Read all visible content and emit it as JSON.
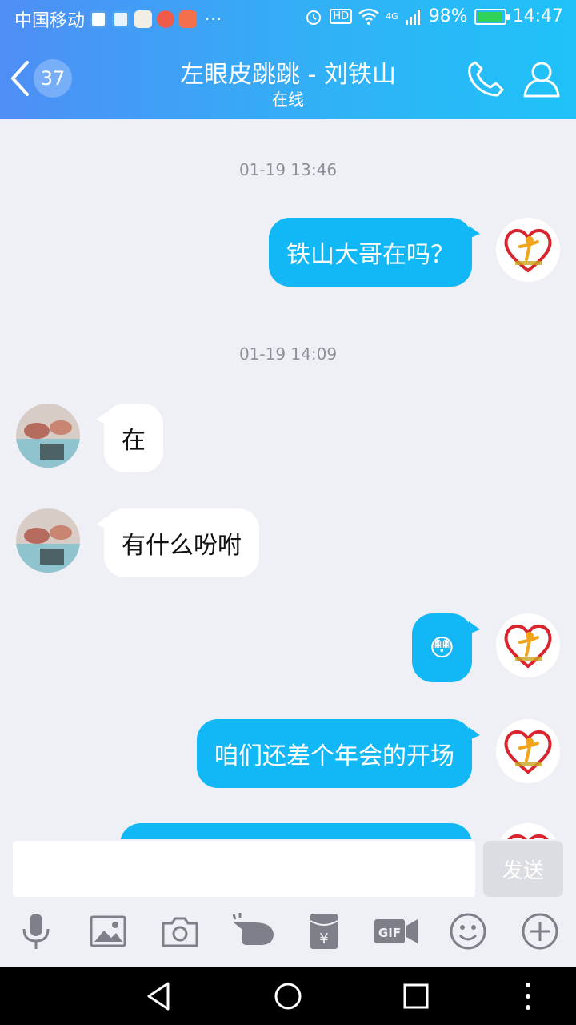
{
  "status_bar": {
    "carrier": "中国移动",
    "dots": "···",
    "hd": "HD",
    "network": "4G",
    "battery": "98%",
    "battery_level": 0.98,
    "time": "14:47"
  },
  "header": {
    "unread_count": "37",
    "title": "左眼皮跳跳 - 刘铁山",
    "subtitle": "在线"
  },
  "messages": [
    {
      "type": "time",
      "text": "01-19 13:46"
    },
    {
      "type": "out",
      "text": "铁山大哥在吗？"
    },
    {
      "type": "time",
      "text": "01-19 14:09"
    },
    {
      "type": "in",
      "text": "在"
    },
    {
      "type": "in",
      "text": "有什么吩咐"
    },
    {
      "type": "out",
      "text": "😳"
    },
    {
      "type": "out",
      "text": "咱们还差个年会的开场"
    }
  ],
  "input": {
    "value": "",
    "send_label": "发送"
  },
  "toolbar": [
    "microphone-icon",
    "image-icon",
    "camera-icon",
    "poke-icon",
    "red-packet-icon",
    "gif-icon",
    "emoji-icon",
    "plus-icon"
  ],
  "colors": {
    "outgoing_bubble": "#12b7f5",
    "incoming_bubble": "#ffffff",
    "background": "#eff0f5",
    "header_gradient_start": "#4f8ef5",
    "header_gradient_end": "#1fc2f8"
  }
}
